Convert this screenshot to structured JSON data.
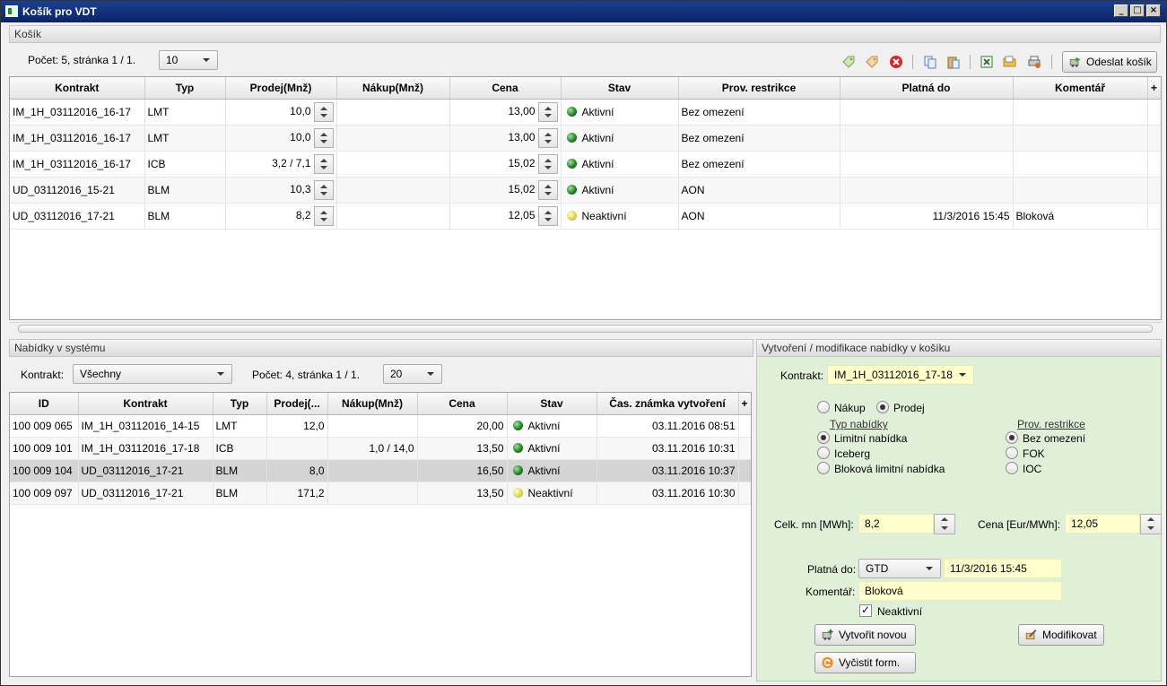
{
  "window": {
    "title": "Košík pro VDT"
  },
  "basket": {
    "header": "Košík",
    "paging_text": "Počet: 5, stránka 1 / 1.",
    "page_size": "10",
    "send_button": "Odeslat košík",
    "columns": [
      "Kontrakt",
      "Typ",
      "Prodej(Mnž)",
      "Nákup(Mnž)",
      "Cena",
      "Stav",
      "Prov. restrikce",
      "Platná do",
      "Komentář"
    ],
    "rows": [
      {
        "kontrakt": "IM_1H_03112016_16-17",
        "typ": "LMT",
        "prodej": "10,0",
        "nakup": "",
        "cena": "13,00",
        "stav": "Aktivní",
        "stav_color": "green",
        "restrikce": "Bez omezení",
        "platna_do": "",
        "komentar": ""
      },
      {
        "kontrakt": "IM_1H_03112016_16-17",
        "typ": "LMT",
        "prodej": "10,0",
        "nakup": "",
        "cena": "13,00",
        "stav": "Aktivní",
        "stav_color": "green",
        "restrikce": "Bez omezení",
        "platna_do": "",
        "komentar": ""
      },
      {
        "kontrakt": "IM_1H_03112016_16-17",
        "typ": "ICB",
        "prodej": "3,2 / 7,1",
        "nakup": "",
        "cena": "15,02",
        "stav": "Aktivní",
        "stav_color": "green",
        "restrikce": "Bez omezení",
        "platna_do": "",
        "komentar": ""
      },
      {
        "kontrakt": "UD_03112016_15-21",
        "typ": "BLM",
        "prodej": "10,3",
        "nakup": "",
        "cena": "15,02",
        "stav": "Aktivní",
        "stav_color": "green",
        "restrikce": "AON",
        "platna_do": "",
        "komentar": ""
      },
      {
        "kontrakt": "UD_03112016_17-21",
        "typ": "BLM",
        "prodej": "8,2",
        "nakup": "",
        "cena": "12,05",
        "stav": "Neaktivní",
        "stav_color": "yellow",
        "restrikce": "AON",
        "platna_do": "11/3/2016 15:45",
        "komentar": "Bloková"
      }
    ]
  },
  "offers": {
    "header": "Nabídky v systému",
    "kontrakt_label": "Kontrakt:",
    "kontrakt_value": "Všechny",
    "paging_text": "Počet: 4, stránka 1 / 1.",
    "page_size": "20",
    "columns": [
      "ID",
      "Kontrakt",
      "Typ",
      "Prodej(...",
      "Nákup(Mnž)",
      "Cena",
      "Stav",
      "Čas. známka vytvoření"
    ],
    "rows": [
      {
        "id": "100 009 065",
        "kontrakt": "IM_1H_03112016_14-15",
        "typ": "LMT",
        "prodej": "12,0",
        "nakup": "",
        "cena": "20,00",
        "stav": "Aktivní",
        "stav_color": "green",
        "cas": "03.11.2016 08:51"
      },
      {
        "id": "100 009 101",
        "kontrakt": "IM_1H_03112016_17-18",
        "typ": "ICB",
        "prodej": "",
        "nakup": "1,0 / 14,0",
        "cena": "13,50",
        "stav": "Aktivní",
        "stav_color": "green",
        "cas": "03.11.2016 10:31"
      },
      {
        "id": "100 009 104",
        "kontrakt": "UD_03112016_17-21",
        "typ": "BLM",
        "prodej": "8,0",
        "nakup": "",
        "cena": "16,50",
        "stav": "Aktivní",
        "stav_color": "green",
        "cas": "03.11.2016 10:37"
      },
      {
        "id": "100 009 097",
        "kontrakt": "UD_03112016_17-21",
        "typ": "BLM",
        "prodej": "171,2",
        "nakup": "",
        "cena": "13,50",
        "stav": "Neaktivní",
        "stav_color": "yellow",
        "cas": "03.11.2016 10:30"
      }
    ]
  },
  "form": {
    "header": "Vytvoření / modifikace nabídky v košíku",
    "kontrakt_label": "Kontrakt:",
    "kontrakt_value": "IM_1H_03112016_17-18",
    "side_buy": "Nákup",
    "side_sell": "Prodej",
    "offer_type_title": "Typ nabídky",
    "offer_types": [
      "Limitní nabídka",
      "Iceberg",
      "Bloková limitní nabídka"
    ],
    "restriction_title": "Prov. restrikce",
    "restrictions": [
      "Bez omezení",
      "FOK",
      "IOC"
    ],
    "qty_label": "Celk. mn [MWh]:",
    "qty_value": "8,2",
    "price_label": "Cena [Eur/MWh]:",
    "price_value": "12,05",
    "valid_label": "Platná do:",
    "valid_type": "GTD",
    "valid_date": "11/3/2016 15:45",
    "comment_label": "Komentář:",
    "comment_value": "Bloková",
    "inactive_label": "Neaktivní",
    "create_button": "Vytvořit novou",
    "modify_button": "Modifikovat",
    "clear_button": "Vyčistit form.",
    "panel_color": "#e0f0d8"
  }
}
